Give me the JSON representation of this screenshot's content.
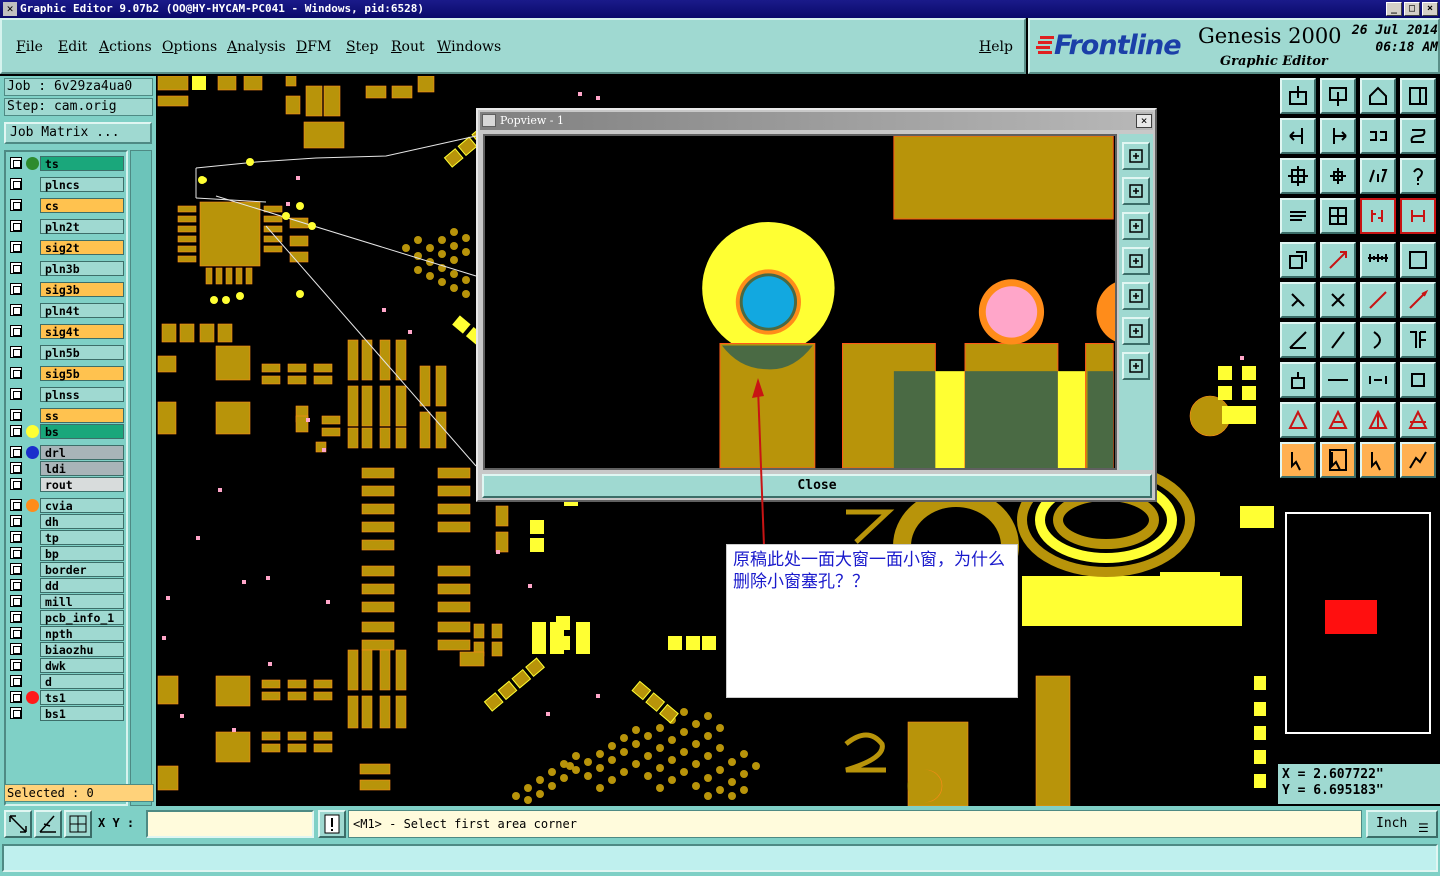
{
  "window": {
    "title": "Graphic Editor 9.07b2 (OO@HY-HYCAM-PC041 - Windows, pid:6528)",
    "controls": [
      "_",
      "□",
      "×"
    ]
  },
  "menu": {
    "items": [
      "File",
      "Edit",
      "Actions",
      "Options",
      "Analysis",
      "DFM",
      "Step",
      "Rout",
      "Windows"
    ],
    "help": "Help"
  },
  "brand": {
    "logo": "Frontline",
    "product": "Genesis 2000",
    "subtitle": "Graphic Editor",
    "date": "26 Jul 2014",
    "time": "06:18 AM"
  },
  "job": {
    "job_line": "Job : 6v29za4ua0",
    "step_line": "Step: cam.orig",
    "matrix_button": "Job Matrix ..."
  },
  "layers": [
    {
      "name": "ts",
      "color": "#1aa77b",
      "dot": "#2e8b2e"
    },
    {
      "name": "plncs",
      "color": "#9fd9d1",
      "dot": ""
    },
    {
      "name": "cs",
      "color": "#ffc24f",
      "dot": ""
    },
    {
      "name": "pln2t",
      "color": "#9fd9d1",
      "dot": ""
    },
    {
      "name": "sig2t",
      "color": "#ffc24f",
      "dot": ""
    },
    {
      "name": "pln3b",
      "color": "#9fd9d1",
      "dot": ""
    },
    {
      "name": "sig3b",
      "color": "#ffc24f",
      "dot": ""
    },
    {
      "name": "pln4t",
      "color": "#9fd9d1",
      "dot": ""
    },
    {
      "name": "sig4t",
      "color": "#ffc24f",
      "dot": ""
    },
    {
      "name": "pln5b",
      "color": "#9fd9d1",
      "dot": ""
    },
    {
      "name": "sig5b",
      "color": "#ffc24f",
      "dot": ""
    },
    {
      "name": "plnss",
      "color": "#9fd9d1",
      "dot": ""
    },
    {
      "name": "ss",
      "color": "#ffc24f",
      "dot": ""
    },
    {
      "name": "bs",
      "color": "#1aa77b",
      "dot": "#ffff33"
    },
    {
      "name": "drl",
      "color": "#a8b4b8",
      "dot": "#1a2ecc"
    },
    {
      "name": "ldi",
      "color": "#a8b4b8",
      "dot": ""
    },
    {
      "name": "rout",
      "color": "#d8dcdc",
      "dot": ""
    },
    {
      "name": "cvia",
      "color": "#9fd9d1",
      "dot": "#ff8c1a"
    },
    {
      "name": "dh",
      "color": "#9fd9d1",
      "dot": ""
    },
    {
      "name": "tp",
      "color": "#9fd9d1",
      "dot": ""
    },
    {
      "name": "bp",
      "color": "#9fd9d1",
      "dot": ""
    },
    {
      "name": "border",
      "color": "#9fd9d1",
      "dot": ""
    },
    {
      "name": "dd",
      "color": "#9fd9d1",
      "dot": ""
    },
    {
      "name": "mill",
      "color": "#9fd9d1",
      "dot": ""
    },
    {
      "name": "pcb_info_1",
      "color": "#9fd9d1",
      "dot": ""
    },
    {
      "name": "npth",
      "color": "#9fd9d1",
      "dot": ""
    },
    {
      "name": "biaozhu",
      "color": "#9fd9d1",
      "dot": ""
    },
    {
      "name": "dwk",
      "color": "#9fd9d1",
      "dot": ""
    },
    {
      "name": "d",
      "color": "#9fd9d1",
      "dot": ""
    },
    {
      "name": "ts1",
      "color": "#9fd9d1",
      "dot": "#ff1a1a"
    },
    {
      "name": "bs1",
      "color": "#9fd9d1",
      "dot": ""
    }
  ],
  "selected": "Selected : 0",
  "coords": {
    "x": "X  =  2.607722\"",
    "y": "Y  =  6.695183\""
  },
  "bottom": {
    "xy_label": "X Y :",
    "xy_value": "",
    "status": "<M1> - Select first area corner",
    "unit": "Inch"
  },
  "popview": {
    "title": "Popview - 1",
    "close_x": "×",
    "close_button": "Close"
  },
  "annotation": {
    "text": "原稿此处一面大窗一面小窗，为什么删除小窗塞孔？？"
  },
  "colors": {
    "copper": "#b8940a",
    "copper_dark": "#4a6a44",
    "bright": "#ffff33",
    "pink": "#ffa6c9",
    "panel": "#7fd0c6",
    "button": "#9fd9d1"
  }
}
